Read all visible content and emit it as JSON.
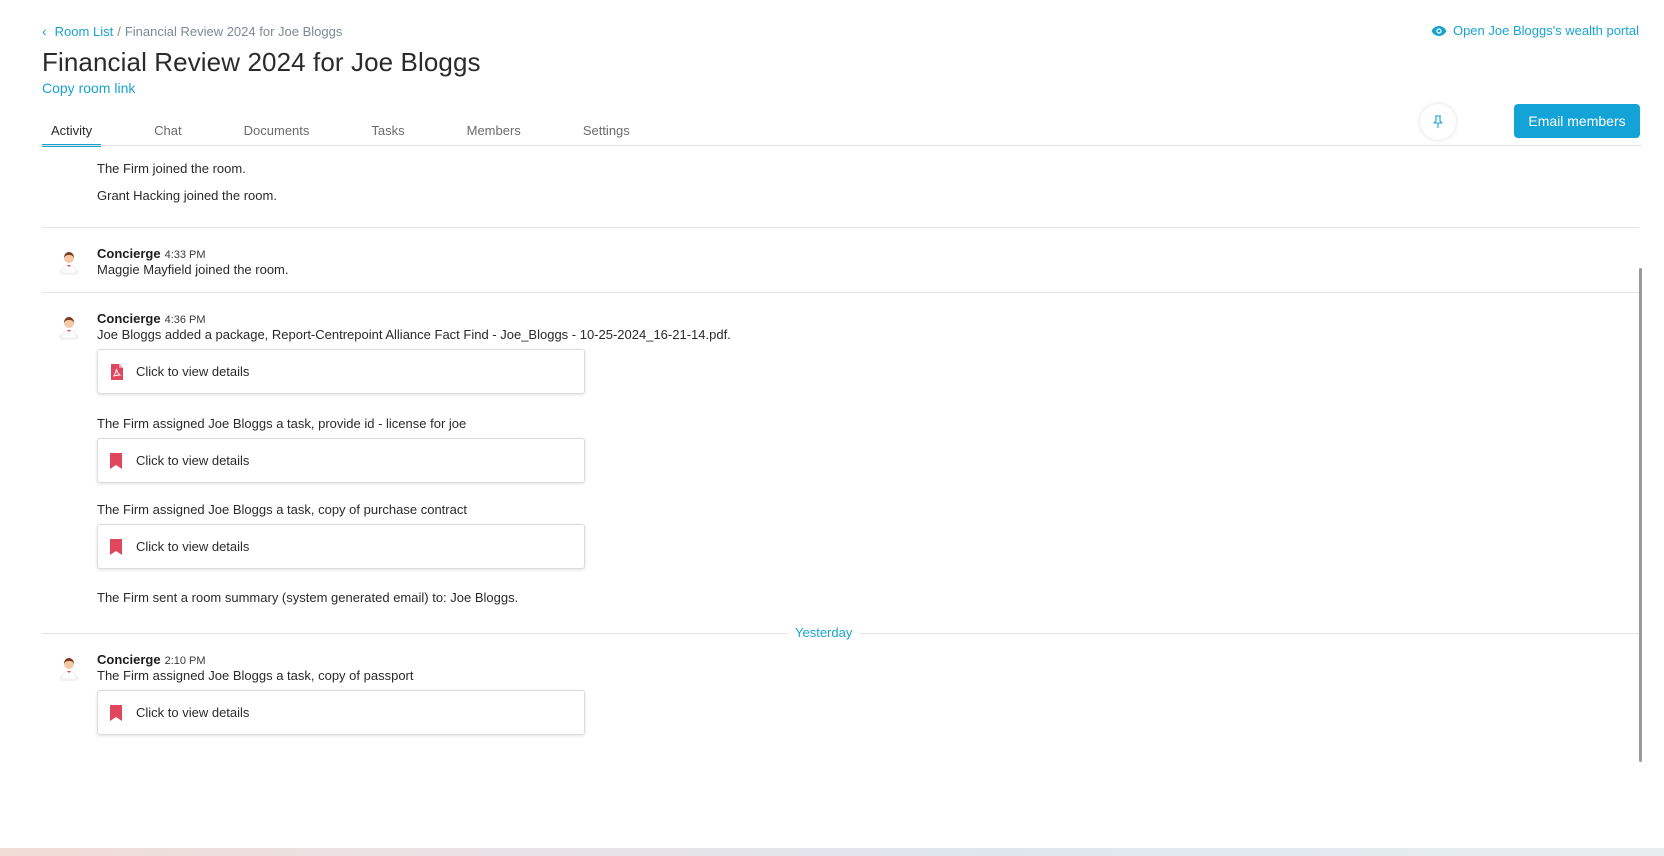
{
  "breadcrumb": {
    "back_label": "Room List",
    "separator": "/",
    "current": "Financial Review 2024 for Joe Bloggs"
  },
  "portal_link": {
    "label": "Open Joe Bloggs's wealth portal",
    "icon": "eye-icon"
  },
  "page_title": "Financial Review 2024 for Joe Bloggs",
  "copy_link": "Copy room link",
  "tabs": [
    {
      "label": "Activity",
      "active": true
    },
    {
      "label": "Chat",
      "active": false
    },
    {
      "label": "Documents",
      "active": false
    },
    {
      "label": "Tasks",
      "active": false
    },
    {
      "label": "Members",
      "active": false
    },
    {
      "label": "Settings",
      "active": false
    }
  ],
  "actions": {
    "pin_icon": "pin-icon",
    "email_button": "Email members"
  },
  "feed": {
    "system_lines": [
      "The Firm joined the room.",
      "Grant Hacking joined the room."
    ],
    "messages": [
      {
        "author": "Concierge",
        "time": "4:33 PM",
        "text": "Maggie Mayfield joined the room."
      },
      {
        "author": "Concierge",
        "time": "4:36 PM",
        "text": "Joe Bloggs added a package, Report-Centrepoint Alliance Fact Find - Joe_Bloggs - 10-25-2024_16-21-14.pdf.",
        "card1": {
          "icon": "pdf-icon",
          "label": "Click to view details"
        },
        "line2": "The Firm assigned Joe Bloggs a task, provide id - license for joe",
        "card2": {
          "icon": "bookmark-icon",
          "label": "Click to view details"
        },
        "line3": "The Firm assigned Joe Bloggs a task, copy of purchase contract",
        "card3": {
          "icon": "bookmark-icon",
          "label": "Click to view details"
        },
        "line4": "The Firm sent a room summary (system generated email) to: Joe Bloggs."
      },
      {
        "author": "Concierge",
        "time": "2:10 PM",
        "text": "The Firm assigned Joe Bloggs a task, copy of passport",
        "card1": {
          "icon": "bookmark-icon",
          "label": "Click to view details"
        }
      }
    ],
    "day_separator": "Yesterday"
  },
  "colors": {
    "accent": "#14a3d6",
    "task_icon": "#e0475c"
  }
}
